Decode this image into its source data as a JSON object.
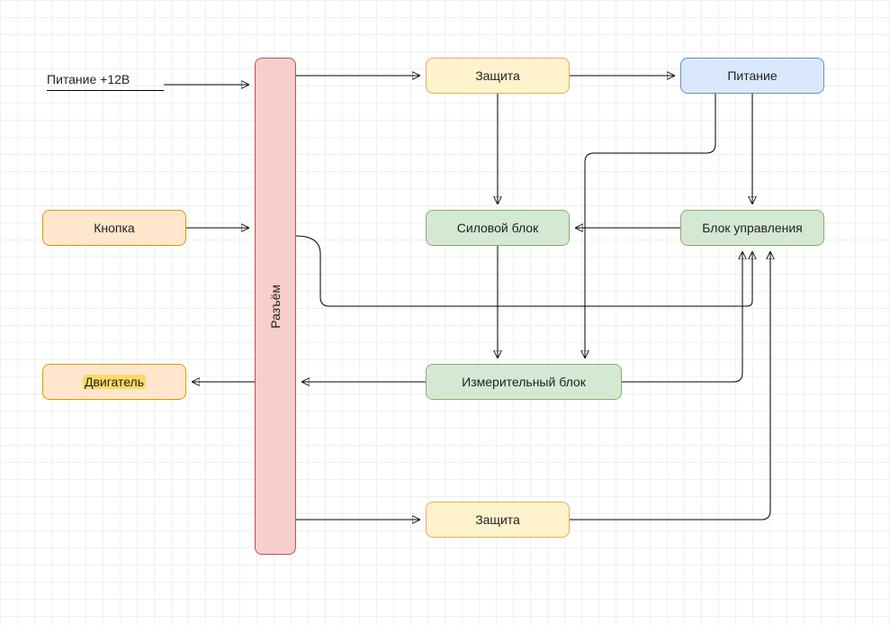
{
  "input_label": "Питание +12В",
  "nodes": {
    "connector": "Разъём",
    "button": "Кнопка",
    "motor": "Двигатель",
    "protection_top": "Защита",
    "protection_bottom": "Защита",
    "power_supply": "Питание",
    "power_block": "Силовой блок",
    "control_block": "Блок управления",
    "measure_block": "Измерительный блок"
  }
}
